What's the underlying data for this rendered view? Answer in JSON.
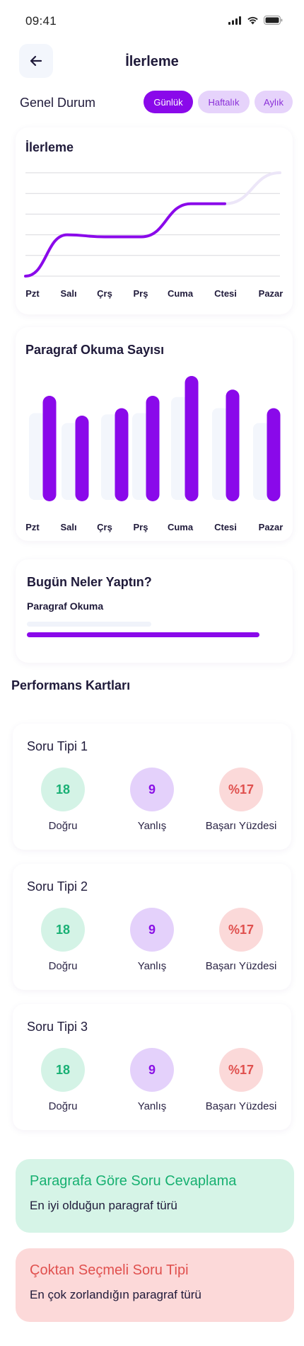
{
  "status_bar": {
    "time": "09:41"
  },
  "header": {
    "title": "İlerleme",
    "back_icon": "arrow-left-icon"
  },
  "overview": {
    "title": "Genel Durum",
    "filters": [
      {
        "label": "Günlük",
        "active": true
      },
      {
        "label": "Haftalık",
        "active": false
      },
      {
        "label": "Aylık",
        "active": false
      }
    ]
  },
  "progress_chart": {
    "title": "İlerleme",
    "days": [
      "Pzt",
      "Salı",
      "Çrş",
      "Prş",
      "Cuma",
      "Ctesi",
      "Pazar"
    ]
  },
  "reading_chart": {
    "title": "Paragraf Okuma Sayısı",
    "days": [
      "Pzt",
      "Salı",
      "Çrş",
      "Prş",
      "Cuma",
      "Ctesi",
      "Pazar"
    ]
  },
  "today": {
    "title": "Bugün Neler Yaptın?",
    "item_label": "Paragraf Okuma",
    "progress": 0.9
  },
  "performance": {
    "title": "Performans Kartları",
    "cards": [
      {
        "title": "Soru Tipi 1",
        "correct": "18",
        "wrong": "9",
        "success": "%17",
        "correct_label": "Doğru",
        "wrong_label": "Yanlış",
        "success_label": "Başarı Yüzdesi"
      },
      {
        "title": "Soru Tipi 2",
        "correct": "18",
        "wrong": "9",
        "success": "%17",
        "correct_label": "Doğru",
        "wrong_label": "Yanlış",
        "success_label": "Başarı Yüzdesi"
      },
      {
        "title": "Soru Tipi 3",
        "correct": "18",
        "wrong": "9",
        "success": "%17",
        "correct_label": "Doğru",
        "wrong_label": "Yanlış",
        "success_label": "Başarı Yüzdesi"
      }
    ]
  },
  "insights": {
    "best": {
      "title": "Paragrafa Göre Soru Cevaplama",
      "subtitle": "En iyi olduğun paragraf türü"
    },
    "worst": {
      "title": "Çoktan Seçmeli Soru Tipi",
      "subtitle": "En çok zorlandığın paragraf türü"
    }
  },
  "colors": {
    "primary": "#8a09ea",
    "pill_inactive": "#e6d3fb",
    "green": "#18b074",
    "red": "#e0504e",
    "best_bg": "#d6f4e7",
    "worst_bg": "#fcd9d9"
  },
  "chart_data": [
    {
      "type": "line",
      "title": "İlerleme",
      "categories": [
        "Pzt",
        "Salı",
        "Çrş",
        "Prş",
        "Cuma",
        "Ctesi",
        "Pazar"
      ],
      "values": [
        0,
        2.0,
        1.9,
        1.9,
        3.5,
        3.5,
        5
      ],
      "grid": true
    },
    {
      "type": "bar",
      "title": "Paragraf Okuma Sayısı",
      "categories": [
        "Pzt",
        "Salı",
        "Çrş",
        "Prş",
        "Cuma",
        "Ctesi",
        "Pazar"
      ],
      "series": [
        {
          "values": [
            0.84,
            0.68,
            0.74,
            0.84,
            1.0,
            0.89,
            0.74
          ]
        },
        {
          "values": [
            0.7,
            0.62,
            0.69,
            0.7,
            0.83,
            0.74,
            0.62
          ]
        }
      ]
    }
  ]
}
